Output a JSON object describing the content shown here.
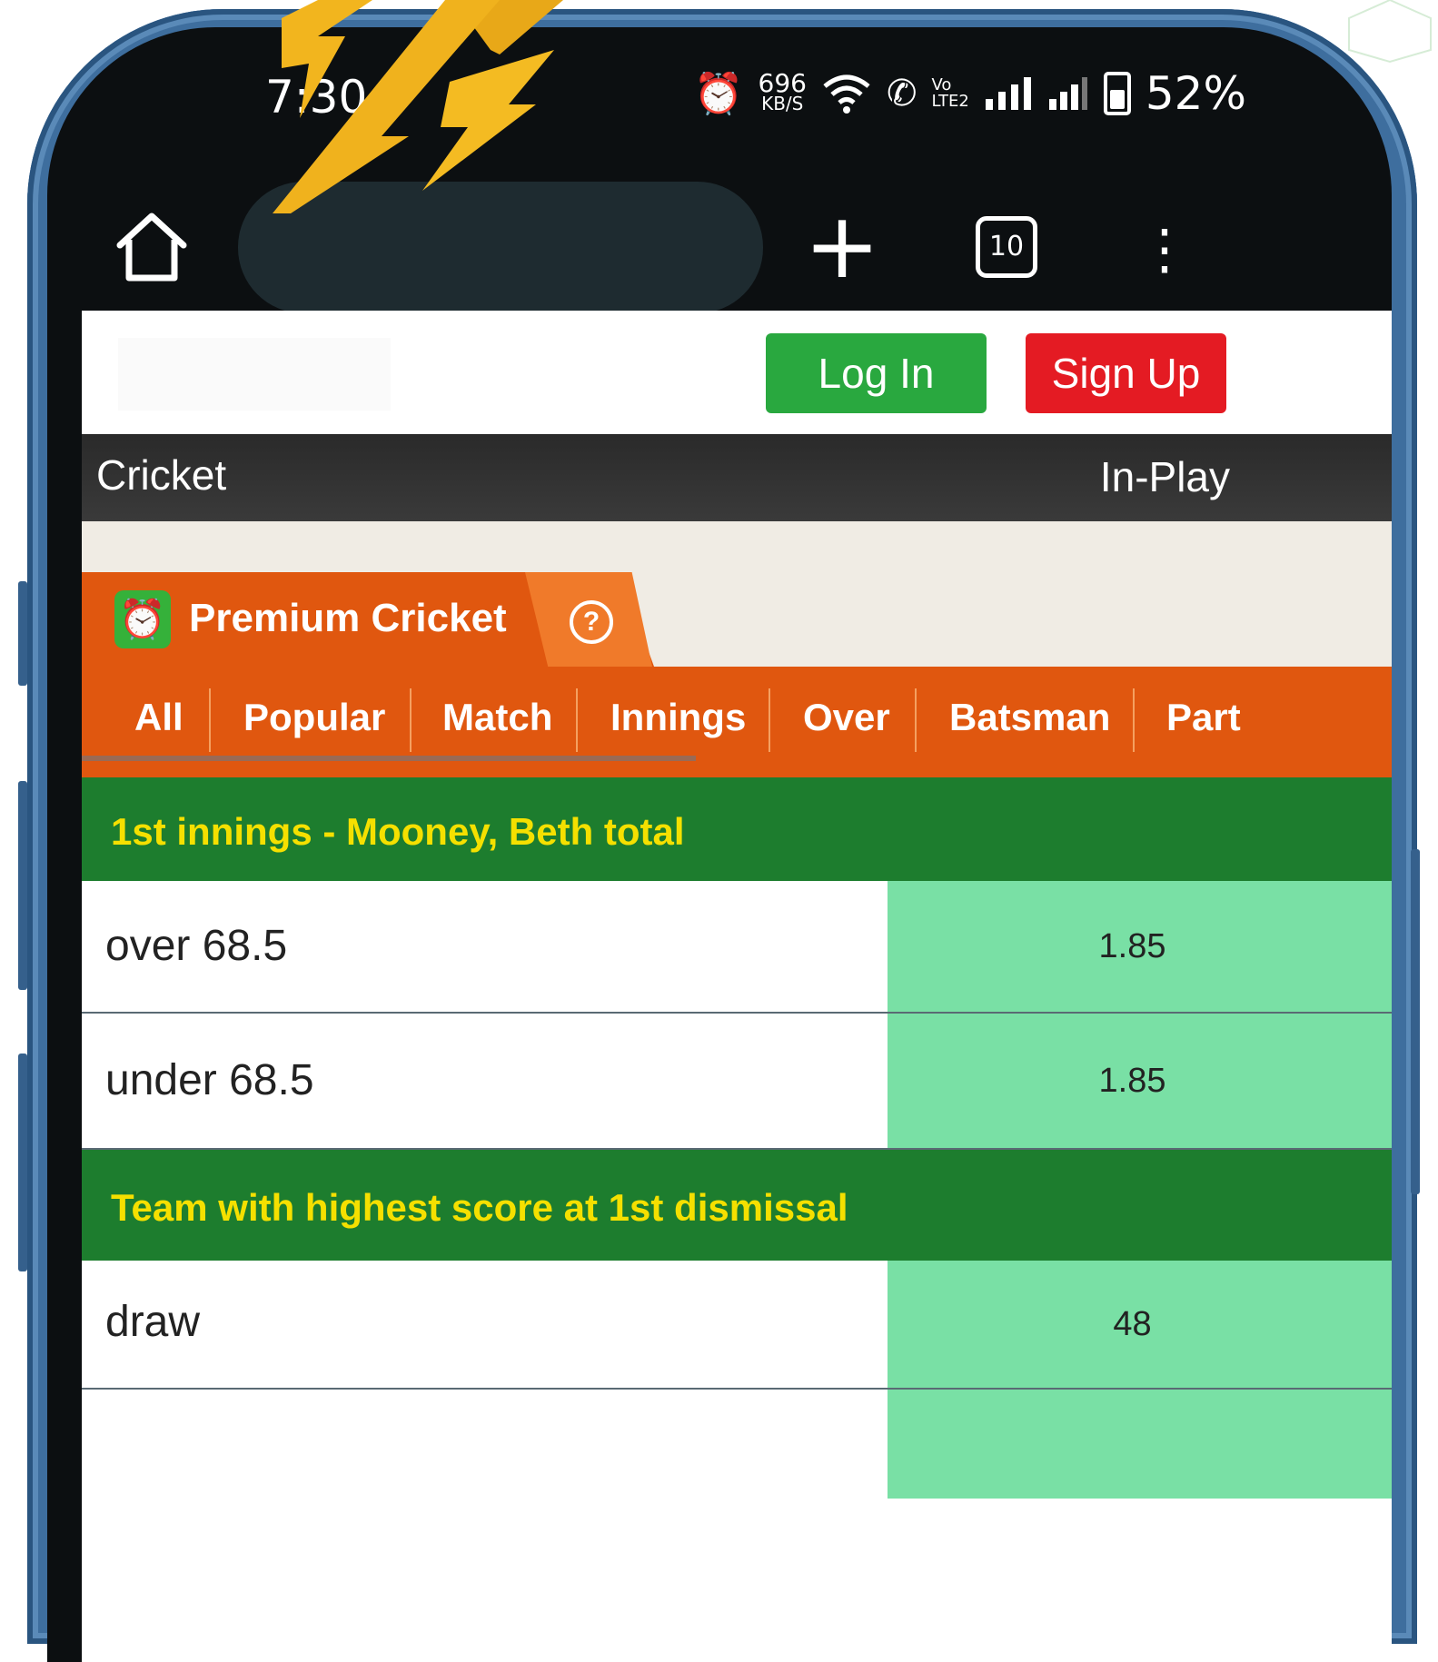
{
  "status_bar": {
    "time": "7:30",
    "net_speed_value": "696",
    "net_speed_unit": "KB/S",
    "volte_top": "Vo",
    "volte_bottom": "LTE2",
    "battery": "52%"
  },
  "browser": {
    "tab_count": "10",
    "new_tab_glyph": "+",
    "menu_glyph": "⋮"
  },
  "header": {
    "login_label": "Log In",
    "signup_label": "Sign Up"
  },
  "sport_bar": {
    "title": "Cricket",
    "inplay": "In-Play"
  },
  "premium": {
    "title": "Premium Cricket",
    "help_glyph": "?",
    "clock_glyph": "⏰"
  },
  "market_tabs": [
    "All",
    "Popular",
    "Match",
    "Innings",
    "Over",
    "Batsman",
    "Part"
  ],
  "markets": [
    {
      "title": "1st innings - Mooney, Beth total",
      "selections": [
        {
          "label": "over 68.5",
          "price": "1.85"
        },
        {
          "label": "under 68.5",
          "price": "1.85"
        }
      ]
    },
    {
      "title": "Team with highest score at 1st dismissal",
      "selections": [
        {
          "label": "draw",
          "price": "48"
        }
      ]
    }
  ],
  "colors": {
    "accent_orange": "#e0570f",
    "market_green": "#1d7d2e",
    "market_title_yellow": "#f5e000",
    "odds_green": "#79e0a5",
    "login_green": "#29a83f",
    "signup_red": "#e41b23"
  }
}
